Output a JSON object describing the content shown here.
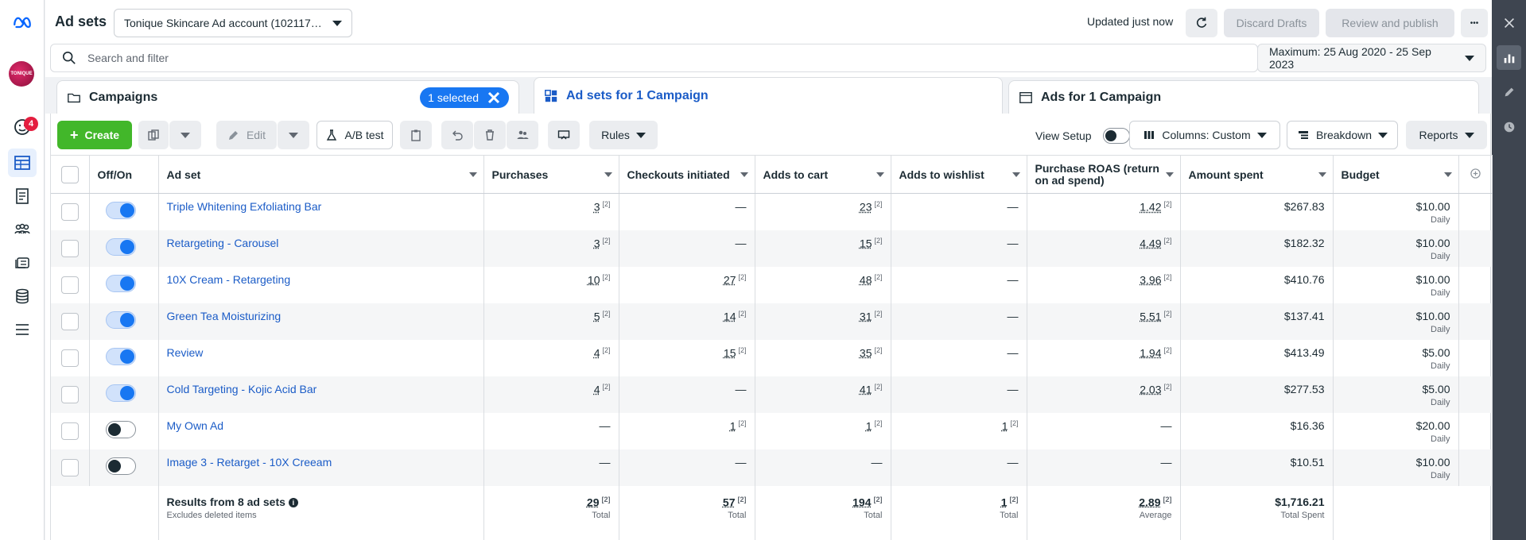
{
  "page_title": "Ad sets",
  "account": "Tonique Skincare Ad account (102117…",
  "updated_text": "Updated just now",
  "discard_label": "Discard Drafts",
  "review_label": "Review and publish",
  "more_label": "•••",
  "search_placeholder": "Search and filter",
  "date_range": "Maximum: 25 Aug 2020 - 25 Sep 2023",
  "notification_count": "4",
  "avatar_text": "TONIQUE",
  "tabs": {
    "campaigns": "Campaigns",
    "selected_chip": "1 selected",
    "adsets": "Ad sets for 1 Campaign",
    "ads": "Ads for 1 Campaign"
  },
  "toolbar": {
    "create": "Create",
    "edit": "Edit",
    "ab_test": "A/B test",
    "rules": "Rules",
    "view_setup": "View Setup",
    "columns": "Columns: Custom",
    "breakdown": "Breakdown",
    "reports": "Reports"
  },
  "columns": [
    "Off/On",
    "Ad set",
    "Purchases",
    "Checkouts initiated",
    "Adds to cart",
    "Adds to wishlist",
    "Purchase ROAS (return on ad spend)",
    "Amount spent",
    "Budget"
  ],
  "superscript": "[2]",
  "rows": [
    {
      "on": true,
      "name": "Triple Whitening Exfoliating Bar",
      "purchases": "3",
      "checkouts": "—",
      "carts": "23",
      "wishlist": "—",
      "roas": "1.42",
      "spent": "$267.83",
      "budget": "$10.00",
      "period": "Daily"
    },
    {
      "on": true,
      "name": "Retargeting - Carousel",
      "purchases": "3",
      "checkouts": "—",
      "carts": "15",
      "wishlist": "—",
      "roas": "4.49",
      "spent": "$182.32",
      "budget": "$10.00",
      "period": "Daily"
    },
    {
      "on": true,
      "name": "10X Cream - Retargeting",
      "purchases": "10",
      "checkouts": "27",
      "carts": "48",
      "wishlist": "—",
      "roas": "3.96",
      "spent": "$410.76",
      "budget": "$10.00",
      "period": "Daily"
    },
    {
      "on": true,
      "name": "Green Tea Moisturizing",
      "purchases": "5",
      "checkouts": "14",
      "carts": "31",
      "wishlist": "—",
      "roas": "5.51",
      "spent": "$137.41",
      "budget": "$10.00",
      "period": "Daily"
    },
    {
      "on": true,
      "name": "Review",
      "purchases": "4",
      "checkouts": "15",
      "carts": "35",
      "wishlist": "—",
      "roas": "1.94",
      "spent": "$413.49",
      "budget": "$5.00",
      "period": "Daily"
    },
    {
      "on": true,
      "name": "Cold Targeting - Kojic Acid Bar",
      "purchases": "4",
      "checkouts": "—",
      "carts": "41",
      "wishlist": "—",
      "roas": "2.03",
      "spent": "$277.53",
      "budget": "$5.00",
      "period": "Daily"
    },
    {
      "on": false,
      "name": "My Own Ad",
      "purchases": "—",
      "checkouts": "1",
      "carts": "1",
      "wishlist": "1",
      "roas": "—",
      "spent": "$16.36",
      "budget": "$20.00",
      "period": "Daily"
    },
    {
      "on": false,
      "name": "Image 3 - Retarget - 10X Creeam",
      "purchases": "—",
      "checkouts": "—",
      "carts": "—",
      "wishlist": "—",
      "roas": "—",
      "spent": "$10.51",
      "budget": "$10.00",
      "period": "Daily"
    }
  ],
  "totals": {
    "label": "Results from 8 ad sets",
    "note": "Excludes deleted items",
    "purchases": "29",
    "purchases_sub": "Total",
    "checkouts": "57",
    "checkouts_sub": "Total",
    "carts": "194",
    "carts_sub": "Total",
    "wishlist": "1",
    "wishlist_sub": "Total",
    "roas": "2.89",
    "roas_sub": "Average",
    "spent": "$1,716.21",
    "spent_sub": "Total Spent"
  },
  "colors": {
    "accent": "#1877f2",
    "create": "#42b72a",
    "link": "#1b5cc7"
  }
}
